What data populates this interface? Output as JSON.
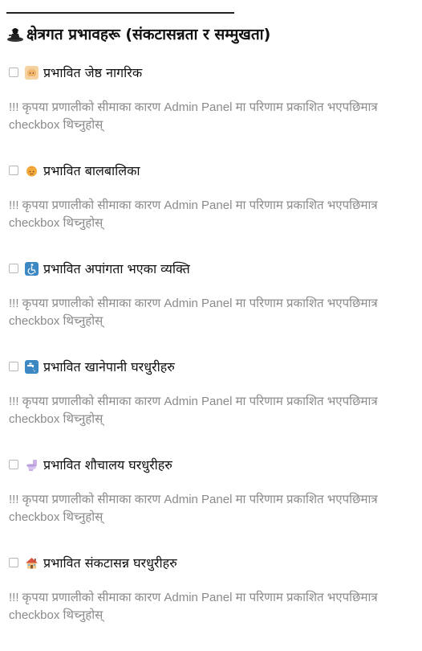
{
  "section": {
    "title": "क्षेत्रगत प्रभावहरू (संकटासन्नता र सम्मुखता)",
    "title_icon": "construction-worker-icon"
  },
  "items": [
    {
      "label": "प्रभावित जेष्ठ नागरिक",
      "icon": "older-person-icon",
      "note": "!!! कृपया प्रणालीको सीमाका कारण Admin Panel मा परिणाम प्रकाशित भएपछिमात्र checkbox थिच्नुहोस्",
      "checked": false
    },
    {
      "label": "प्रभावित बालबालिका",
      "icon": "child-icon",
      "note": "!!! कृपया प्रणालीको सीमाका कारण Admin Panel मा परिणाम प्रकाशित भएपछिमात्र checkbox थिच्नुहोस्",
      "checked": false
    },
    {
      "label": "प्रभावित अपांगता भएका व्यक्ति",
      "icon": "wheelchair-icon",
      "note": "!!! कृपया प्रणालीको सीमाका कारण Admin Panel मा परिणाम प्रकाशित भएपछिमात्र checkbox थिच्नुहोस्",
      "checked": false
    },
    {
      "label": "प्रभावित खानेपानी घरधुरीहरु",
      "icon": "water-tap-icon",
      "note": "!!! कृपया प्रणालीको सीमाका कारण Admin Panel मा परिणाम प्रकाशित भएपछिमात्र checkbox थिच्नुहोस्",
      "checked": false
    },
    {
      "label": "प्रभावित शौचालय घरधुरीहरु",
      "icon": "toilet-icon",
      "note": "!!! कृपया प्रणालीको सीमाका कारण Admin Panel मा परिणाम प्रकाशित भएपछिमात्र checkbox थिच्नुहोस्",
      "checked": false
    },
    {
      "label": "प्रभावित संकटासन्न घरधुरीहरु",
      "icon": "house-icon",
      "note": "!!! कृपया प्रणालीको सीमाका कारण Admin Panel मा परिणाम प्रकाशित भएपछिमात्र checkbox थिच्नुहोस्",
      "checked": false
    }
  ]
}
